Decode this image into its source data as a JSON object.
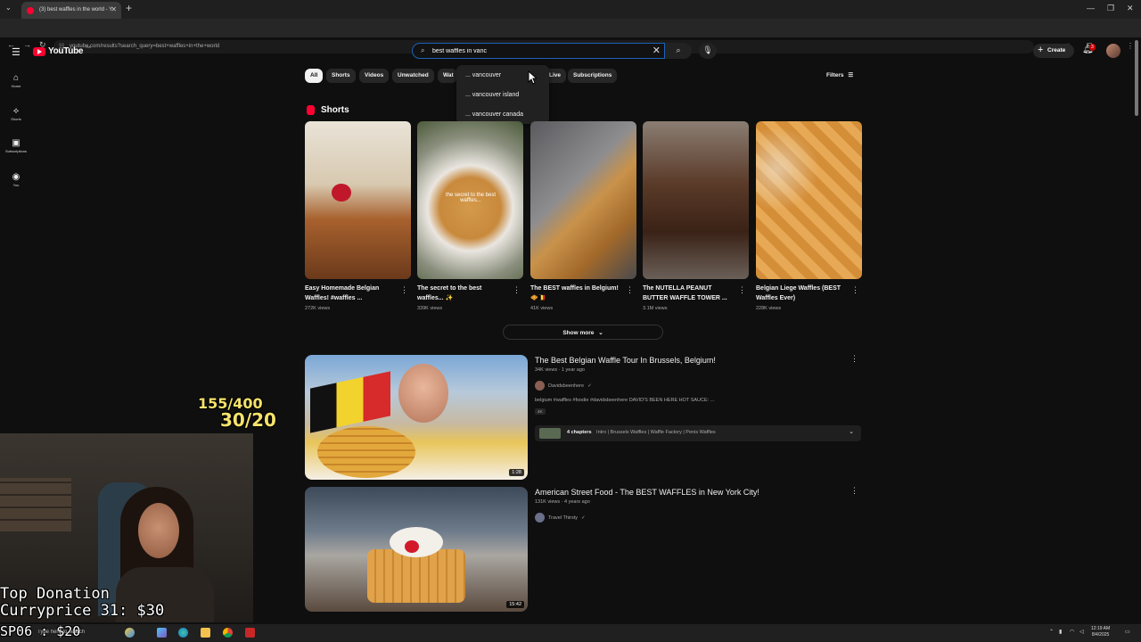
{
  "browser": {
    "tab_title": "(3) best waffles in the world - Y",
    "url": "youtube.com/results?search_query=best+waffles+in+the+world"
  },
  "header": {
    "logo_text": "YouTube",
    "country_code": "CA",
    "search_value": "best waffles in vanc",
    "create_label": "Create",
    "notification_count": "3"
  },
  "sidebar": {
    "items": [
      {
        "label": "Home",
        "icon": "home-icon"
      },
      {
        "label": "Shorts",
        "icon": "shorts-icon"
      },
      {
        "label": "Subscriptions",
        "icon": "subscriptions-icon"
      },
      {
        "label": "You",
        "icon": "you-icon"
      }
    ]
  },
  "chips": {
    "items": [
      "All",
      "Shorts",
      "Videos",
      "Unwatched",
      "Wat",
      "Live",
      "Subscriptions"
    ],
    "active": "All",
    "filters_label": "Filters"
  },
  "autocomplete": {
    "suggestions": [
      "... vancouver",
      "... vancouver island",
      "... vancouver canada"
    ]
  },
  "shorts": {
    "section_title": "Shorts",
    "items": [
      {
        "title": "Easy Homemade Belgian Waffles! #waffles ...",
        "views": "272K views"
      },
      {
        "title": "The secret to the best waffles... ✨",
        "views": "339K views",
        "overlay": "the secret to the best waffles..."
      },
      {
        "title": "The BEST waffles in Belgium! 🧇🇧🇪",
        "views": "41K views"
      },
      {
        "title": "The NUTELLA PEANUT BUTTER WAFFLE TOWER ...",
        "views": "3.1M views"
      },
      {
        "title": "Belgian Liege Waffles (BEST Waffles Ever)",
        "views": "228K views"
      }
    ],
    "show_more": "Show more"
  },
  "videos": [
    {
      "title": "The Best Belgian Waffle Tour In Brussels, Belgium!",
      "meta": "34K views · 1 year ago",
      "channel": "Davidsbeenhere",
      "description": "belgium #waffles #foodie #davidsbeenhere DAVID'S BEEN HERE HOT SAUCE: ...",
      "tag": "4K",
      "chapters": "4 chapters",
      "chapter_list": "Intro | Brussels Waffles | Waffle Factory | Penis Waffles",
      "duration": "1:28"
    },
    {
      "title": "American Street Food - The BEST WAFFLES in New York City!",
      "meta": "131K views · 4 years ago",
      "channel": "Travel Thirsty",
      "duration": "15:42"
    }
  ],
  "overlay": {
    "counter_top": "155/400",
    "counter_bottom": "30/20",
    "donation_title": "Top Donation",
    "donation_line": "Curryprice 31: $30",
    "donation_line2": "SP06 : $20"
  },
  "taskbar": {
    "search_text": "Type here to search",
    "time": "12:19 AM",
    "date": "8/4/2025"
  },
  "colors": {
    "background": "#0f0f0f",
    "accent": "#ff0033",
    "search_border": "#1c62b9",
    "counter": "#f5e26b"
  }
}
